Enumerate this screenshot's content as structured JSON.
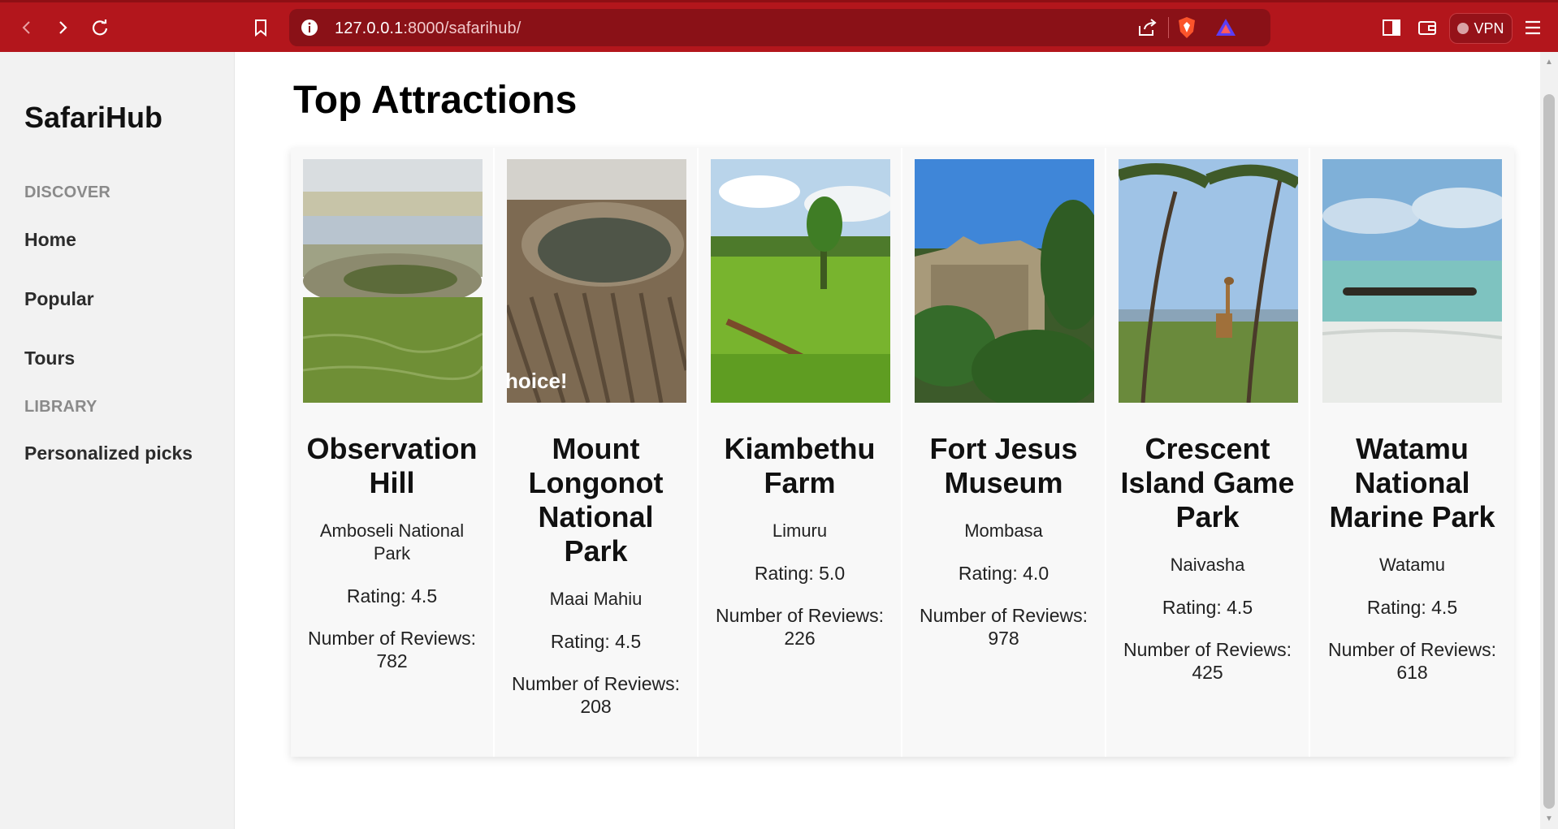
{
  "browser": {
    "url_host": "127.0.0.1",
    "url_path": ":8000/safarihub/",
    "vpn_label": "VPN",
    "accent": "#b3161c"
  },
  "sidebar": {
    "brand": "SafariHub",
    "discover_label": "DISCOVER",
    "items": [
      {
        "label": "Home"
      },
      {
        "label": "Popular"
      },
      {
        "label": "Tours"
      }
    ],
    "library_label": "LIBRARY",
    "library_items": [
      {
        "label": "Personalized picks"
      }
    ]
  },
  "main": {
    "title": "Top Attractions",
    "cards": [
      {
        "name": "Observation Hill",
        "location": "Amboseli National Park",
        "rating": "Rating: 4.5",
        "reviews": "Number of Reviews: 782",
        "image": "grassland-lake-landscape"
      },
      {
        "name": "Mount Longonot National Park",
        "location": "Maai Mahiu",
        "rating": "Rating: 4.5",
        "reviews": "Number of Reviews: 208",
        "image": "volcanic-crater",
        "watermark": "hoice!"
      },
      {
        "name": "Kiambethu Farm",
        "location": "Limuru",
        "rating": "Rating: 5.0",
        "reviews": "Number of Reviews: 226",
        "image": "tea-plantation"
      },
      {
        "name": "Fort Jesus Museum",
        "location": "Mombasa",
        "rating": "Rating: 4.0",
        "reviews": "Number of Reviews: 978",
        "image": "fort-ruins"
      },
      {
        "name": "Crescent Island Game Park",
        "location": "Naivasha",
        "rating": "Rating: 4.5",
        "reviews": "Number of Reviews: 425",
        "image": "giraffe-acacia"
      },
      {
        "name": "Watamu National Marine Park",
        "location": "Watamu",
        "rating": "Rating: 4.5",
        "reviews": "Number of Reviews: 618",
        "image": "beach-boat"
      }
    ]
  }
}
